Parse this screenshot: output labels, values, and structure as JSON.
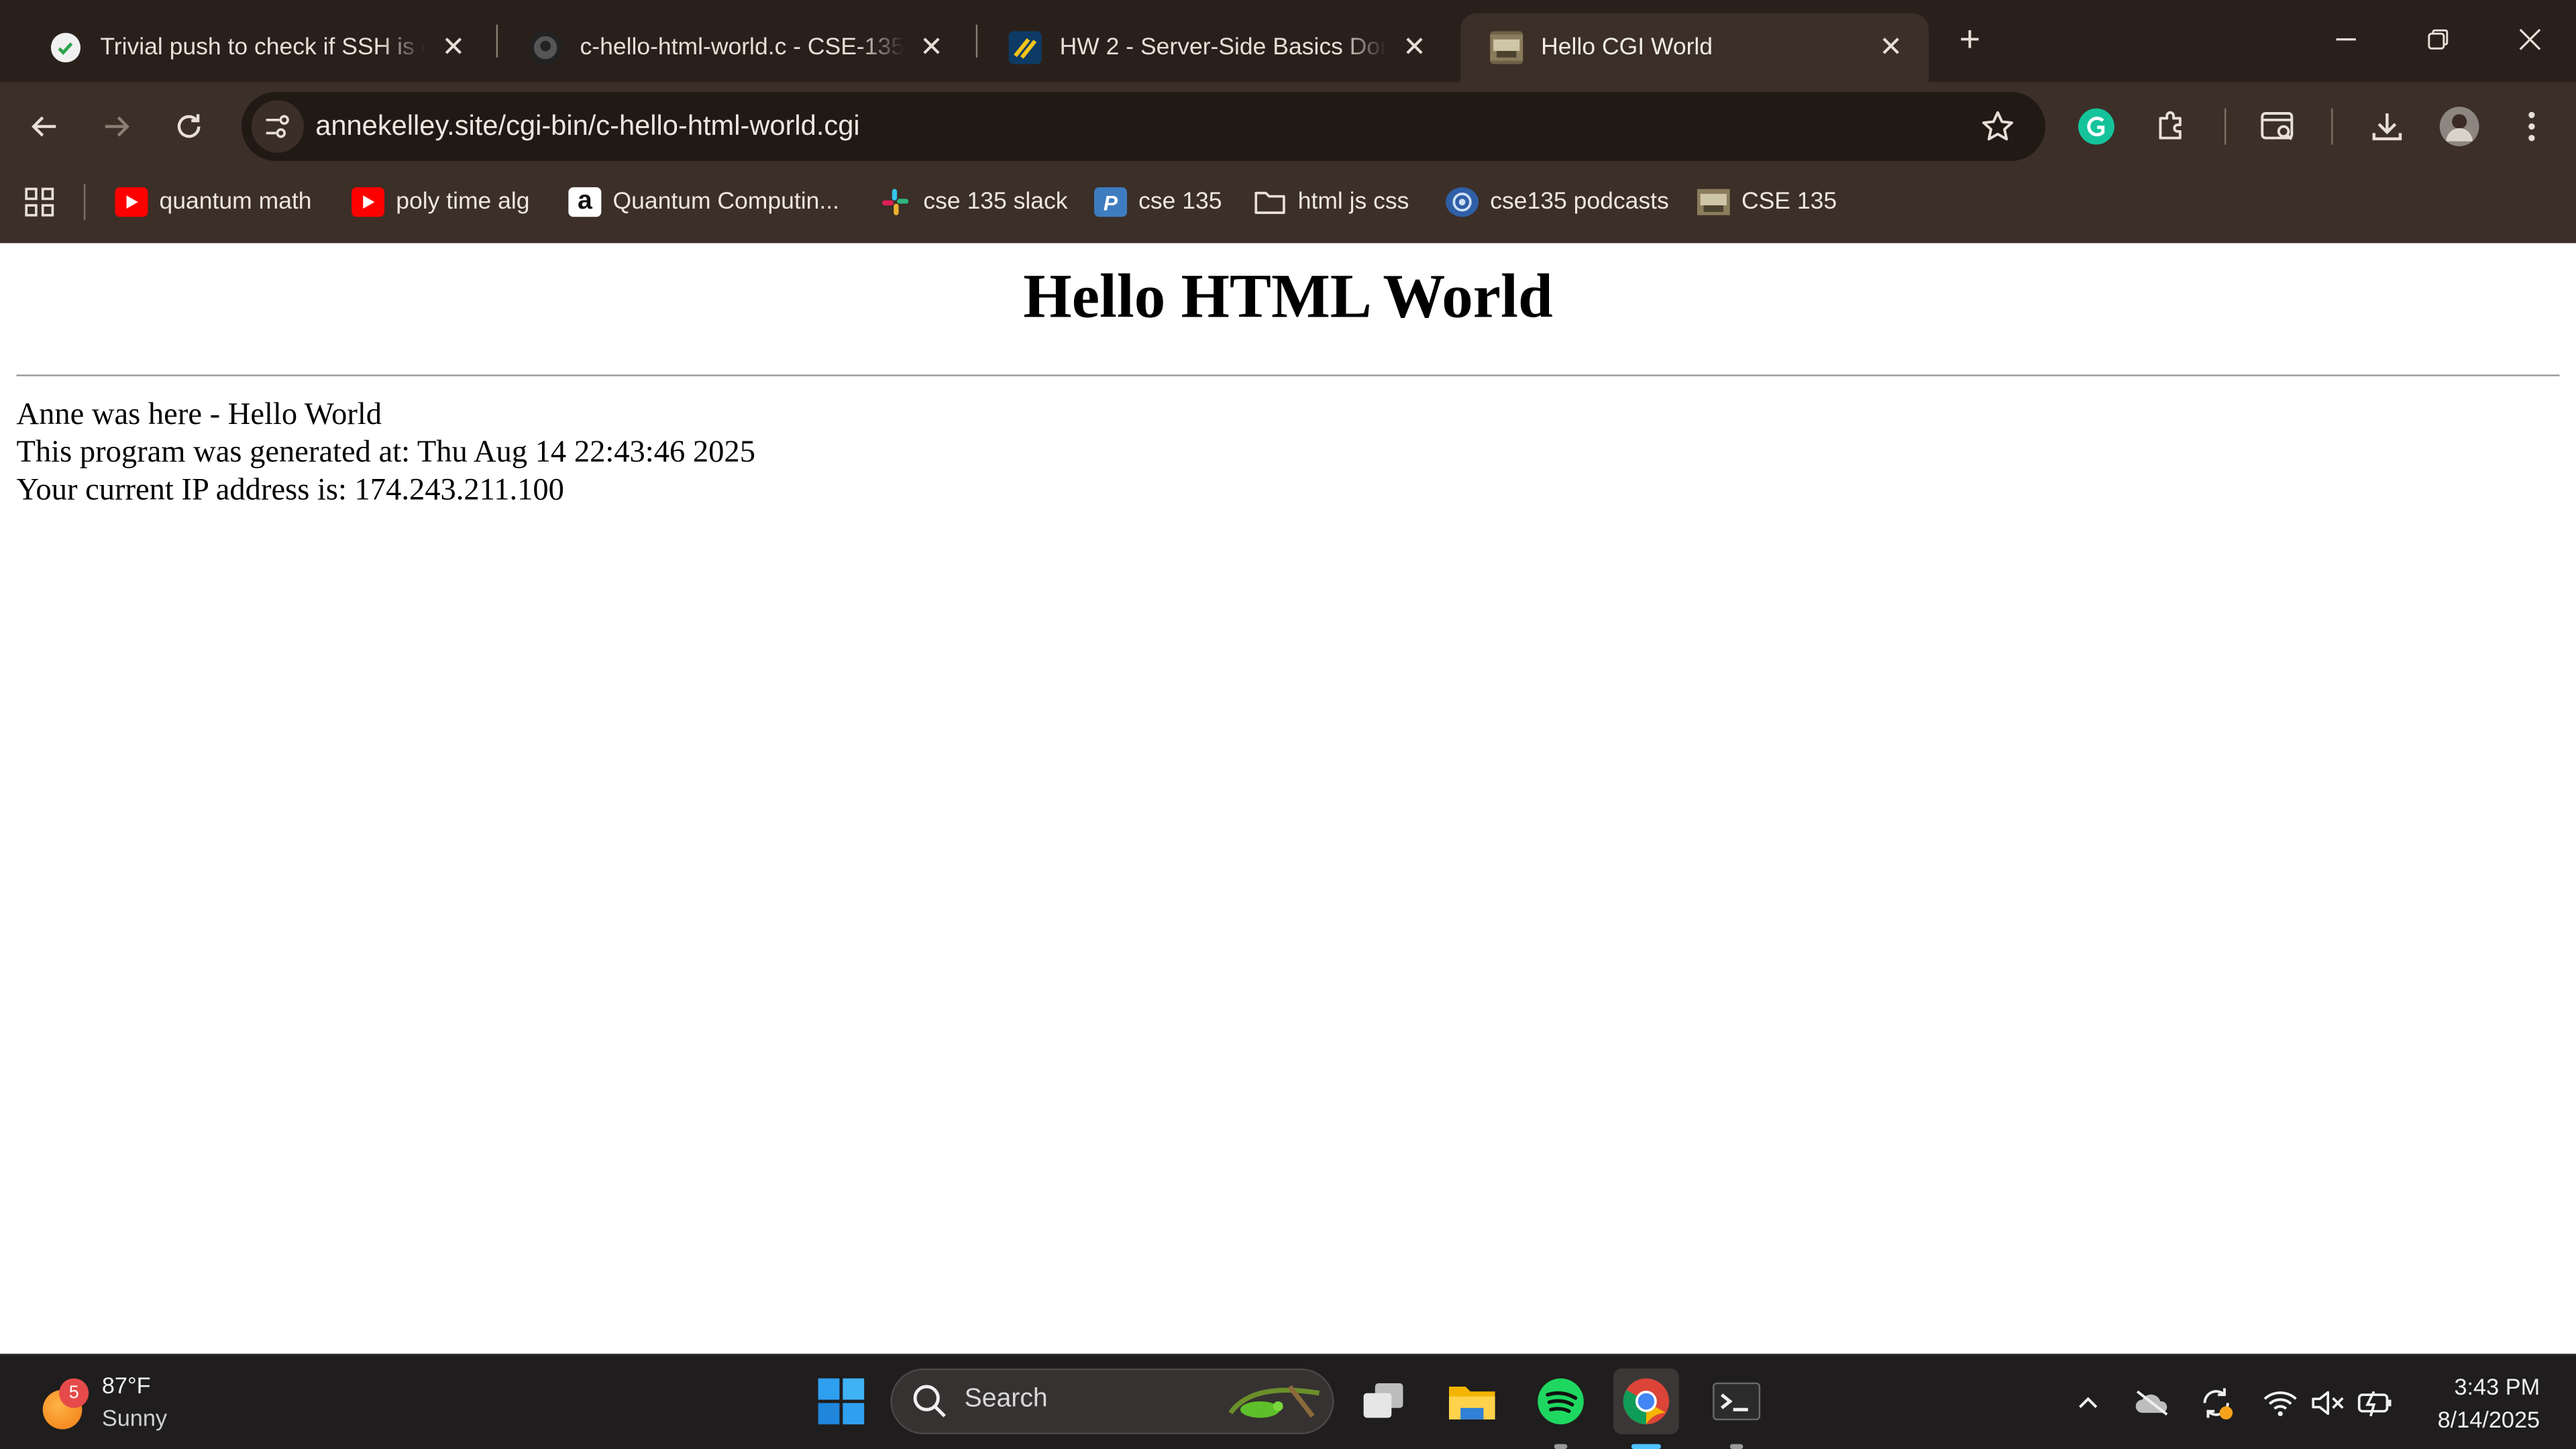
{
  "browser": {
    "tabs": [
      {
        "title": "Trivial push to check if SSH is co",
        "icon": "github-check-icon"
      },
      {
        "title": "c-hello-html-world.c - CSE-135-",
        "icon": "github-icon"
      },
      {
        "title": "HW 2 - Server-Side Basics Done",
        "icon": "course-icon"
      },
      {
        "title": "Hello CGI World",
        "icon": "site-icon",
        "active": true
      }
    ],
    "url": "annekelley.site/cgi-bin/c-hello-html-world.cgi",
    "bookmarks": [
      {
        "label": "quantum math",
        "icon": "youtube-icon"
      },
      {
        "label": "poly time alg",
        "icon": "youtube-icon"
      },
      {
        "label": "Quantum Computin...",
        "icon": "amazon-icon"
      },
      {
        "label": "cse 135 slack",
        "icon": "slack-icon"
      },
      {
        "label": "cse 135",
        "icon": "p-icon"
      },
      {
        "label": "html js css",
        "icon": "folder-icon"
      },
      {
        "label": "cse135 podcasts",
        "icon": "podcast-icon"
      },
      {
        "label": "CSE 135",
        "icon": "site-icon"
      }
    ]
  },
  "page": {
    "heading": "Hello HTML World",
    "lines": [
      "Anne was here - Hello World",
      "This program was generated at: Thu Aug 14 22:43:46 2025",
      "Your current IP address is: 174.243.211.100"
    ]
  },
  "taskbar": {
    "weather_temp": "87°F",
    "weather_cond": "Sunny",
    "weather_badge": "5",
    "search_placeholder": "Search",
    "time": "3:43 PM",
    "date": "8/14/2025"
  },
  "colors": {
    "tabstrip": "#2a201b",
    "toolbar": "#3b2f28",
    "omnibox": "#211914",
    "taskbar": "#1f1d1d"
  }
}
